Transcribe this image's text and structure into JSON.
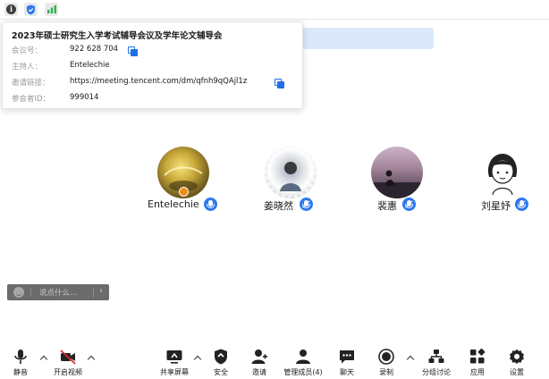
{
  "status_icons": [
    "info-icon",
    "shield-icon",
    "signal-icon"
  ],
  "meeting_info": {
    "title": "2023年硕士研究生入学考试辅导会议及学年论文辅导会",
    "rows": [
      {
        "label": "会议号：",
        "value": "922 628 704"
      },
      {
        "label": "主持人：",
        "value": "Entelechie"
      },
      {
        "label": "邀请链接：",
        "value": "https://meeting.tencent.com/dm/qfnh9qQAjl1z"
      },
      {
        "label": "参会者ID：",
        "value": "999014"
      }
    ]
  },
  "participants": [
    {
      "name": "Entelechie",
      "mic": "active"
    },
    {
      "name": "姜晓然",
      "mic": "muted"
    },
    {
      "name": "裴惠",
      "mic": "muted"
    },
    {
      "name": "刘星妤",
      "mic": "muted"
    }
  ],
  "chat": {
    "placeholder": "说点什么..."
  },
  "toolbar": {
    "mute": "静音",
    "video": "开启视频",
    "share": "共享屏幕",
    "security": "安全",
    "invite": "邀请",
    "members": "管理成员(4)",
    "chat": "聊天",
    "record": "录制",
    "breakout": "分组讨论",
    "apps": "应用",
    "settings": "设置"
  },
  "colors": {
    "accent": "#2d78f0",
    "banner": "#dbe8fb",
    "chatbar": "#6b6b6b"
  }
}
